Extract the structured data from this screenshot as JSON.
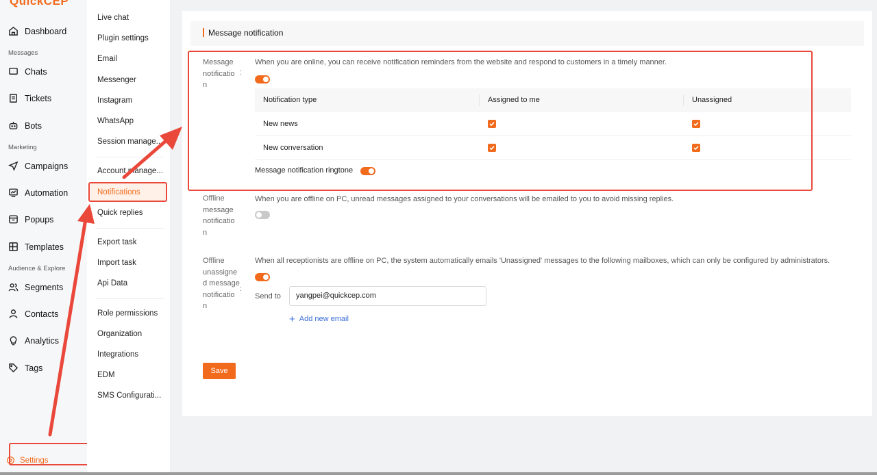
{
  "app": {
    "logo_text": "QuickCEP",
    "brand_color": "#f26b1d",
    "annotation_color": "#e9483a"
  },
  "leftnav": {
    "items": [
      {
        "label": "Dashboard",
        "icon": "home-icon"
      },
      {
        "label": "Chats",
        "icon": "chat-icon"
      },
      {
        "label": "Tickets",
        "icon": "ticket-icon"
      },
      {
        "label": "Bots",
        "icon": "bot-icon"
      },
      {
        "label": "Campaigns",
        "icon": "send-icon"
      },
      {
        "label": "Automation",
        "icon": "automation-icon"
      },
      {
        "label": "Popups",
        "icon": "popup-icon"
      },
      {
        "label": "Templates",
        "icon": "templates-icon"
      },
      {
        "label": "Segments",
        "icon": "users-icon"
      },
      {
        "label": "Contacts",
        "icon": "contact-icon"
      },
      {
        "label": "Analytics",
        "icon": "bulb-icon"
      },
      {
        "label": "Tags",
        "icon": "tag-icon"
      }
    ],
    "sections": {
      "messages": "Messages",
      "marketing": "Marketing",
      "audience": "Audience & Explore"
    },
    "settings_label": "Settings"
  },
  "submenu": {
    "items": [
      "Live chat",
      "Plugin settings",
      "Email",
      "Messenger",
      "Instagram",
      "WhatsApp",
      "Session manage...",
      "Account manage...",
      "Notifications",
      "Quick replies",
      "Export task",
      "Import task",
      "Api Data",
      "Role permissions",
      "Organization",
      "Integrations",
      "EDM",
      "SMS Configurati..."
    ],
    "active": "Notifications"
  },
  "main": {
    "card_title": "Message notification",
    "message_notification": {
      "label": "Message notificatio n",
      "description": "When you are online, you can receive notification reminders from the website and respond to customers in a timely manner.",
      "enabled": true,
      "table": {
        "headers": [
          "Notification type",
          "Assigned to me",
          "Unassigned"
        ],
        "rows": [
          {
            "type": "New news",
            "assigned": true,
            "unassigned": true
          },
          {
            "type": "New conversation",
            "assigned": true,
            "unassigned": true
          }
        ]
      },
      "ringtone_label": "Message notification ringtone",
      "ringtone_enabled": true
    },
    "offline_message": {
      "label": "Offline message notificatio n",
      "description": "When you are offline on PC, unread messages assigned to your conversations will be emailed to you to avoid missing replies.",
      "enabled": false
    },
    "offline_unassigned": {
      "label": "Offline unassigne d message notificatio n",
      "description": "When all receptionists are offline on PC, the system automatically emails 'Unassigned' messages to the following mailboxes, which can only be configured by administrators.",
      "enabled": true,
      "send_to_label": "Send to",
      "email": "yangpei@quickcep.com",
      "add_email_label": "Add new email"
    },
    "save_label": "Save"
  }
}
